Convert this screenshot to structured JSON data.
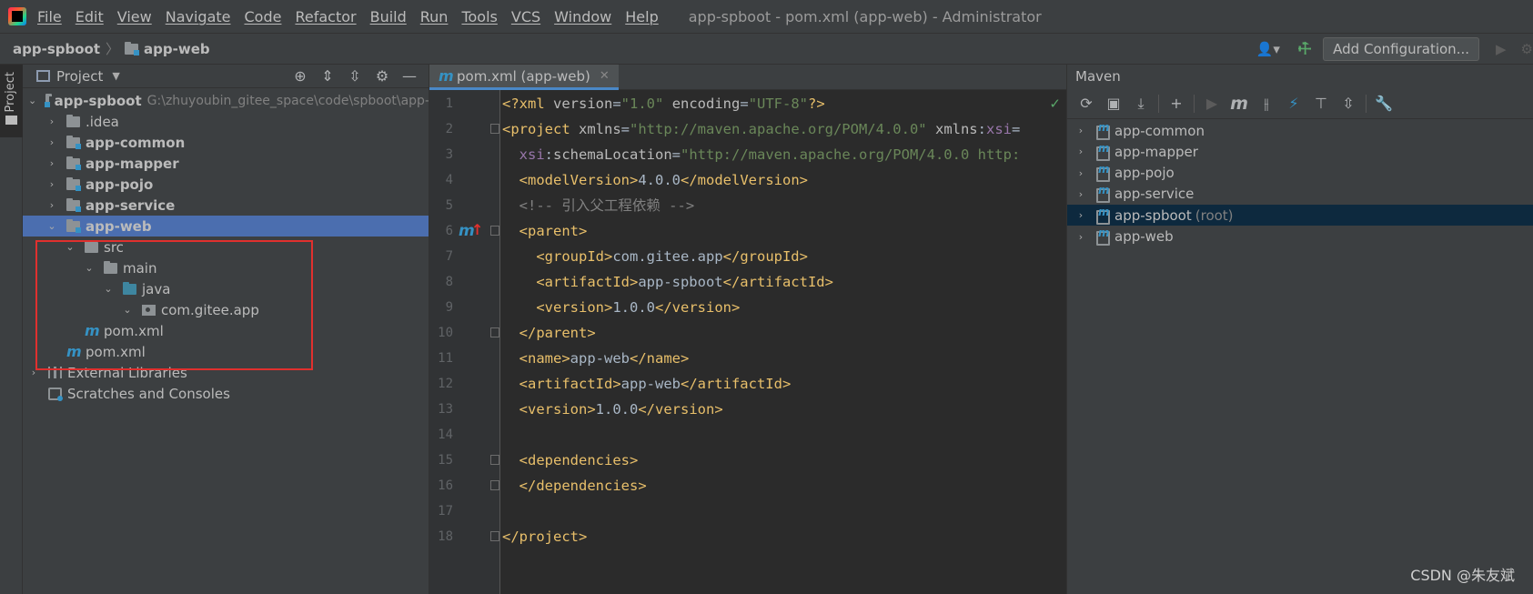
{
  "menubar": {
    "items": [
      "File",
      "Edit",
      "View",
      "Navigate",
      "Code",
      "Refactor",
      "Build",
      "Run",
      "Tools",
      "VCS",
      "Window",
      "Help"
    ],
    "window_title": "app-spboot - pom.xml (app-web) - Administrator"
  },
  "navbar": {
    "breadcrumbs": [
      "app-spboot",
      "app-web"
    ],
    "add_config_label": "Add Configuration..."
  },
  "left_strip": {
    "project_label": "Project"
  },
  "project_panel": {
    "title": "Project",
    "tree": [
      {
        "label": "app-spboot",
        "path": "G:\\zhuyoubin_gitee_space\\code\\spboot\\app-",
        "bold": true
      },
      {
        "label": ".idea"
      },
      {
        "label": "app-common",
        "bold": true
      },
      {
        "label": "app-mapper",
        "bold": true
      },
      {
        "label": "app-pojo",
        "bold": true
      },
      {
        "label": "app-service",
        "bold": true
      },
      {
        "label": "app-web",
        "bold": true
      },
      {
        "label": "src"
      },
      {
        "label": "main"
      },
      {
        "label": "java"
      },
      {
        "label": "com.gitee.app"
      },
      {
        "label": "pom.xml"
      },
      {
        "label": "pom.xml"
      },
      {
        "label": "External Libraries"
      },
      {
        "label": "Scratches and Consoles"
      }
    ]
  },
  "editor": {
    "tab_label": "pom.xml (app-web)",
    "line_numbers": [
      "1",
      "2",
      "3",
      "4",
      "5",
      "6",
      "7",
      "8",
      "9",
      "10",
      "11",
      "12",
      "13",
      "14",
      "15",
      "16",
      "17",
      "18"
    ],
    "gutter_marker": "m",
    "lines": [
      [
        {
          "t": "tag",
          "v": "<?xml "
        },
        {
          "t": "attr",
          "v": "version"
        },
        {
          "t": "txt",
          "v": "="
        },
        {
          "t": "val",
          "v": "\"1.0\""
        },
        {
          "t": "txt",
          "v": " "
        },
        {
          "t": "attr",
          "v": "encoding"
        },
        {
          "t": "txt",
          "v": "="
        },
        {
          "t": "val",
          "v": "\"UTF-8\""
        },
        {
          "t": "tag",
          "v": "?>"
        }
      ],
      [
        {
          "t": "tag",
          "v": "<project "
        },
        {
          "t": "attr",
          "v": "xmlns"
        },
        {
          "t": "txt",
          "v": "="
        },
        {
          "t": "val",
          "v": "\"http://maven.apache.org/POM/4.0.0\""
        },
        {
          "t": "txt",
          "v": " "
        },
        {
          "t": "attr",
          "v": "xmlns"
        },
        {
          "t": "txt",
          "v": ":"
        },
        {
          "t": "ns",
          "v": "xsi"
        },
        {
          "t": "txt",
          "v": "="
        }
      ],
      [
        {
          "t": "txt",
          "v": "  "
        },
        {
          "t": "ns",
          "v": "xsi"
        },
        {
          "t": "txt",
          "v": ":"
        },
        {
          "t": "attr",
          "v": "schemaLocation"
        },
        {
          "t": "txt",
          "v": "="
        },
        {
          "t": "val",
          "v": "\"http://maven.apache.org/POM/4.0.0 http:"
        }
      ],
      [
        {
          "t": "txt",
          "v": "  "
        },
        {
          "t": "tag",
          "v": "<modelVersion>"
        },
        {
          "t": "txt",
          "v": "4.0.0"
        },
        {
          "t": "tag",
          "v": "</modelVersion>"
        }
      ],
      [
        {
          "t": "txt",
          "v": "  "
        },
        {
          "t": "comment",
          "v": "<!-- 引入父工程依赖 -->"
        }
      ],
      [
        {
          "t": "txt",
          "v": "  "
        },
        {
          "t": "tag",
          "v": "<parent>"
        }
      ],
      [
        {
          "t": "txt",
          "v": "    "
        },
        {
          "t": "tag",
          "v": "<groupId>"
        },
        {
          "t": "txt",
          "v": "com.gitee.app"
        },
        {
          "t": "tag",
          "v": "</groupId>"
        }
      ],
      [
        {
          "t": "txt",
          "v": "    "
        },
        {
          "t": "tag",
          "v": "<artifactId>"
        },
        {
          "t": "txt",
          "v": "app-spboot"
        },
        {
          "t": "tag",
          "v": "</artifactId>"
        }
      ],
      [
        {
          "t": "txt",
          "v": "    "
        },
        {
          "t": "tag",
          "v": "<version>"
        },
        {
          "t": "txt",
          "v": "1.0.0"
        },
        {
          "t": "tag",
          "v": "</version>"
        }
      ],
      [
        {
          "t": "txt",
          "v": "  "
        },
        {
          "t": "tag",
          "v": "</parent>"
        }
      ],
      [
        {
          "t": "txt",
          "v": "  "
        },
        {
          "t": "tag",
          "v": "<name>"
        },
        {
          "t": "txt",
          "v": "app-web"
        },
        {
          "t": "tag",
          "v": "</name>"
        }
      ],
      [
        {
          "t": "txt",
          "v": "  "
        },
        {
          "t": "tag",
          "v": "<artifactId>"
        },
        {
          "t": "txt",
          "v": "app-web"
        },
        {
          "t": "tag",
          "v": "</artifactId>"
        }
      ],
      [
        {
          "t": "txt",
          "v": "  "
        },
        {
          "t": "tag",
          "v": "<version>"
        },
        {
          "t": "txt",
          "v": "1.0.0"
        },
        {
          "t": "tag",
          "v": "</version>"
        }
      ],
      [],
      [
        {
          "t": "txt",
          "v": "  "
        },
        {
          "t": "tag",
          "v": "<dependencies>"
        }
      ],
      [
        {
          "t": "txt",
          "v": "  "
        },
        {
          "t": "tag",
          "v": "</dependencies>"
        }
      ],
      [],
      [
        {
          "t": "tag",
          "v": "</project>"
        }
      ]
    ]
  },
  "maven_panel": {
    "title": "Maven",
    "projects": [
      {
        "label": "app-common",
        "suffix": ""
      },
      {
        "label": "app-mapper",
        "suffix": ""
      },
      {
        "label": "app-pojo",
        "suffix": ""
      },
      {
        "label": "app-service",
        "suffix": ""
      },
      {
        "label": "app-spboot",
        "suffix": "(root)"
      },
      {
        "label": "app-web",
        "suffix": ""
      }
    ]
  },
  "watermark": "CSDN @朱友斌",
  "colors": {
    "accent": "#4b6eaf",
    "highlight_box": "#e0302e",
    "maven_selected": "#0d293e",
    "xml_tag": "#e8bf6a",
    "xml_value": "#6a8759"
  }
}
